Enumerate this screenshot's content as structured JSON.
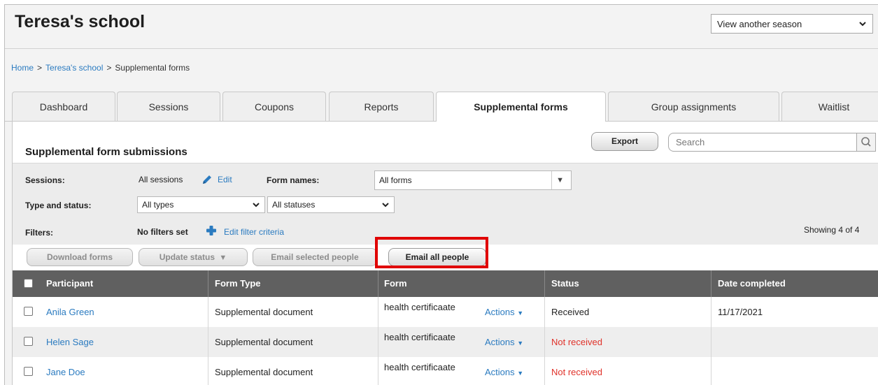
{
  "header": {
    "school_name": "Teresa's school",
    "season_select": "View another season"
  },
  "breadcrumb": {
    "home": "Home",
    "school": "Teresa's school",
    "current": "Supplemental forms",
    "separator": ">"
  },
  "tabs": [
    {
      "label": "Dashboard"
    },
    {
      "label": "Sessions"
    },
    {
      "label": "Coupons"
    },
    {
      "label": "Reports"
    },
    {
      "label": "Supplemental forms",
      "active": true
    },
    {
      "label": "Group assignments"
    },
    {
      "label": "Waitlist"
    }
  ],
  "section": {
    "title": "Supplemental form submissions",
    "export_label": "Export",
    "search_placeholder": "Search"
  },
  "filters": {
    "sessions_label": "Sessions:",
    "sessions_value": "All sessions",
    "edit_label": "Edit",
    "form_names_label": "Form names:",
    "form_names_value": "All forms",
    "type_status_label": "Type and status:",
    "type_value": "All types",
    "status_value": "All statuses",
    "filters_label": "Filters:",
    "filters_value": "No filters set",
    "edit_filter_label": "Edit filter criteria",
    "showing": "Showing 4 of 4"
  },
  "actions": {
    "download": "Download forms",
    "update_status": "Update status",
    "email_selected": "Email selected people",
    "email_all": "Email all people"
  },
  "table": {
    "headers": [
      "Participant",
      "Form Type",
      "Form",
      "Status",
      "Date completed"
    ],
    "rows": [
      {
        "participant": "Anila Green",
        "form_type": "Supplemental document",
        "form": "health certificaate",
        "actions": "Actions",
        "status": "Received",
        "date": "11/17/2021"
      },
      {
        "participant": "Helen Sage",
        "form_type": "Supplemental document",
        "form": "health certificaate",
        "actions": "Actions",
        "status": "Not received",
        "date": ""
      },
      {
        "participant": "Jane Doe",
        "form_type": "Supplemental document",
        "form": "health certificaate",
        "actions": "Actions",
        "status": "Not received",
        "date": ""
      }
    ]
  },
  "colors": {
    "link": "#2b7bc0",
    "not_received": "#e0322a",
    "highlight": "#e00000",
    "table_header": "#606060"
  }
}
